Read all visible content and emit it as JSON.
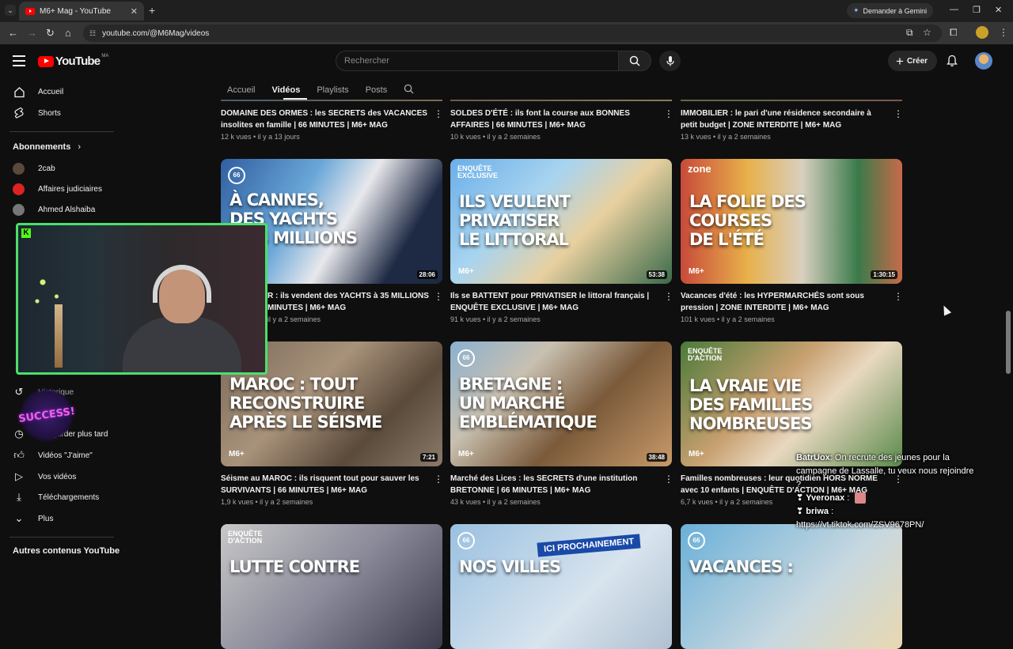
{
  "browser": {
    "tab_title": "M6+ Mag - YouTube",
    "url": "youtube.com/@M6Mag/videos",
    "gemini_button": "Demander à Gemini"
  },
  "header": {
    "logo_text": "YouTube",
    "logo_country": "MA",
    "search_placeholder": "Rechercher",
    "create_label": "Créer"
  },
  "sidebar": {
    "items": [
      {
        "label": "Accueil"
      },
      {
        "label": "Shorts"
      }
    ],
    "subscriptions_title": "Abonnements",
    "subscriptions": [
      {
        "label": "2cab"
      },
      {
        "label": "Affaires judiciaires"
      },
      {
        "label": "Ahmed Alshaiba"
      }
    ],
    "you_items": [
      {
        "label": "Historique"
      },
      {
        "label": "À regarder plus tard"
      },
      {
        "label": "Vidéos \"J'aime\""
      },
      {
        "label": "Vos vidéos"
      },
      {
        "label": "Téléchargements"
      },
      {
        "label": "Plus"
      }
    ],
    "other_title": "Autres contenus YouTube"
  },
  "channel_tabs": [
    "Accueil",
    "Vidéos",
    "Playlists",
    "Posts"
  ],
  "videos_row0": [
    {
      "title": "DOMAINE DES ORMES : les SECRETS des VACANCES insolites en famille | 66 MINUTES | M6+ MAG",
      "meta": "12 k vues • il y a 13 jours"
    },
    {
      "title": "SOLDES D'ÉTÉ : ils font la course aux BONNES AFFAIRES | 66 MINUTES | M6+ MAG",
      "meta": "10 k vues • il y a 2 semaines"
    },
    {
      "title": "IMMOBILIER : le pari d'une résidence secondaire à petit budget | ZONE INTERDITE | M6+ MAG",
      "meta": "13 k vues • il y a 2 semaines"
    }
  ],
  "videos_row1": [
    {
      "title": "À CANNES : ils vendent des YACHTS à 35 MILLIONS | 66 MINUTES | M6+ MAG",
      "meta": "il y a 2 semaines",
      "overlay": "À CANNES,\nDES YACHTS\nÀ 35 MILLIONS",
      "duration": "28:06",
      "brand": "66",
      "visible_title": "R : ils vendent des YACHTS à 35 MILLIONS",
      "visible_title2": "MINUTES | M6+ MAG"
    },
    {
      "title": "Ils se BATTENT pour PRIVATISER le littoral français | ENQUÊTE EXCLUSIVE | M6+ MAG",
      "meta": "91 k vues • il y a 2 semaines",
      "overlay": "ILS VEULENT\nPRIVATISER\nLE LITTORAL",
      "duration": "53:38",
      "brand": "ENQUÊTE\nEXCLUSIVE"
    },
    {
      "title": "Vacances d'été : les HYPERMARCHÉS sont sous pression | ZONE INTERDITE | M6+ MAG",
      "meta": "101 k vues • il y a 2 semaines",
      "overlay": "LA FOLIE DES\nCOURSES\nDE L'ÉTÉ",
      "duration": "1:30:15",
      "brand": "zone"
    }
  ],
  "videos_row2": [
    {
      "title": "Séisme au MAROC : ils risquent tout pour sauver les SURVIVANTS | 66 MINUTES | M6+ MAG",
      "meta": "1,9 k vues • il y a 2 semaines",
      "overlay": "MAROC : TOUT\nRECONSTRUIRE\nAPRÈS LE SÉISME",
      "duration": "7:21",
      "brand": "66"
    },
    {
      "title": "Marché des Lices : les SECRETS d'une institution BRETONNE | 66 MINUTES | M6+ MAG",
      "meta": "43 k vues • il y a 2 semaines",
      "overlay": "BRETAGNE :\nUN MARCHÉ\nEMBLÉMATIQUE",
      "duration": "38:48",
      "brand": "66"
    },
    {
      "title": "Familles nombreuses : leur quotidien HORS NORME avec 10 enfants | ENQUÊTE D'ACTION | M6+ MAG",
      "meta": "6,7 k vues • il y a 2 semaines",
      "overlay": "LA VRAIE VIE\nDES FAMILLES\nNOMBREUSES",
      "duration": "",
      "brand": "ENQUÊTE\nD'ACTION"
    }
  ],
  "videos_row3": [
    {
      "overlay": "LUTTE CONTRE",
      "brand": "ENQUÊTE\nD'ACTION"
    },
    {
      "overlay": "NOS VILLES",
      "brand": "66",
      "sign": "ICI PROCHAINEMENT"
    },
    {
      "overlay": "VACANCES :",
      "brand": "66"
    }
  ],
  "m6_label": "M6+",
  "overlay_badge": "SUCCESS!",
  "chat": [
    {
      "user": "BatrUox",
      "text": ": On recrute des jeunes pour la campagne de Lassalle, tu veux nous rejoindre ?"
    },
    {
      "user": "Yveronax",
      "text": " :"
    },
    {
      "user": "briwa",
      "text": " :"
    },
    {
      "user": "",
      "text": "https://vt.tiktok.com/ZSV9678PN/"
    }
  ],
  "colors": {
    "accent": "#ff0000",
    "webcam_border": "#4ae06a",
    "kick_green": "#53fc18"
  }
}
